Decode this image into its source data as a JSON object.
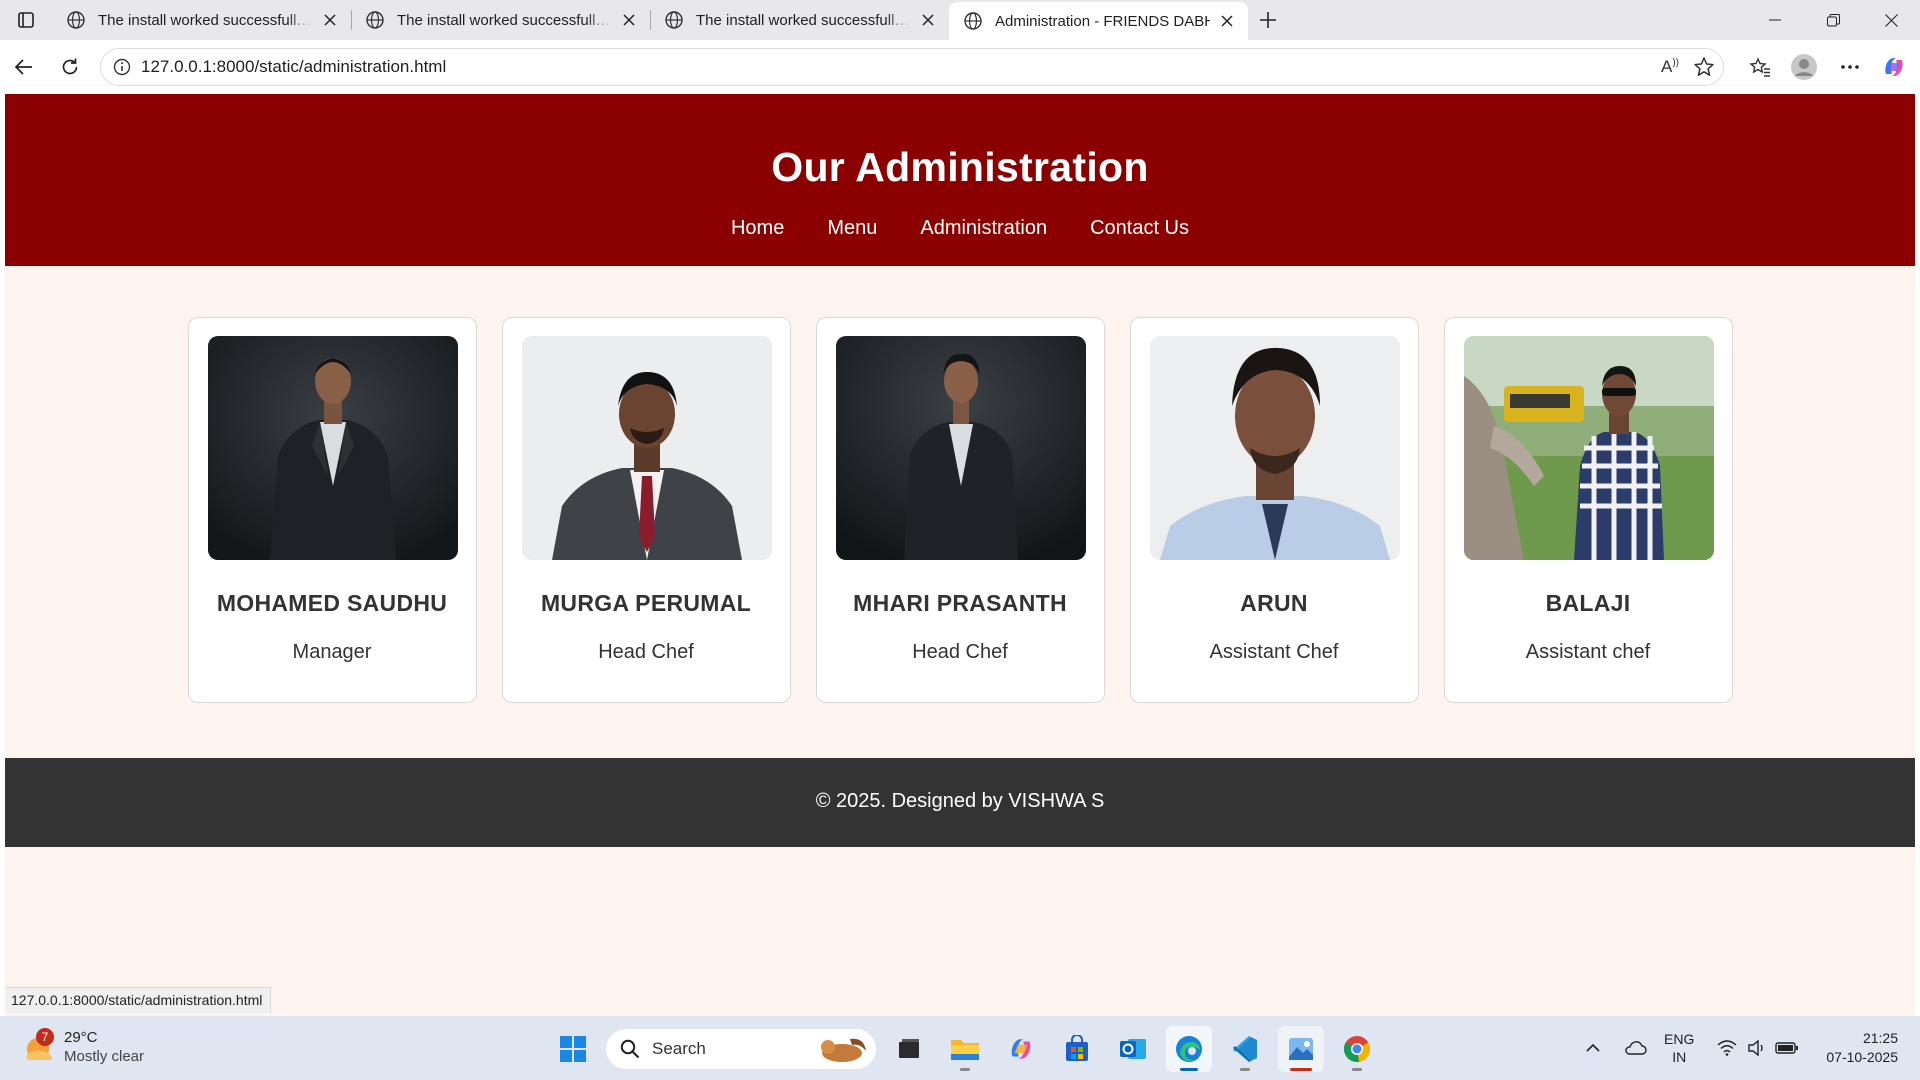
{
  "browser": {
    "tabs": [
      {
        "title": "The install worked successfully! Congratulations!",
        "active": false
      },
      {
        "title": "The install worked successfully! Congratulations!",
        "active": false
      },
      {
        "title": "The install worked successfully! Congratulations!",
        "active": false
      },
      {
        "title": "Administration - FRIENDS DABHA",
        "active": true
      }
    ],
    "url": "127.0.0.1:8000/static/administration.html",
    "status_url": "127.0.0.1:8000/static/administration.html"
  },
  "page": {
    "title": "Our Administration",
    "nav": [
      "Home",
      "Menu",
      "Administration",
      "Contact Us"
    ],
    "team": [
      {
        "name": "MOHAMED SAUDHU",
        "role": "Manager"
      },
      {
        "name": "MURGA PERUMAL",
        "role": "Head Chef"
      },
      {
        "name": "MHARI PRASANTH",
        "role": "Head Chef"
      },
      {
        "name": "ARUN",
        "role": "Assistant Chef"
      },
      {
        "name": "BALAJI",
        "role": "Assistant chef"
      }
    ],
    "footer": "© 2025. Designed by VISHWA S"
  },
  "taskbar": {
    "weather": {
      "temp": "29°C",
      "desc": "Mostly clear",
      "badge": "7"
    },
    "search_label": "Search",
    "lang_line1": "ENG",
    "lang_line2": "IN",
    "time": "21:25",
    "date": "07-10-2025"
  },
  "colors": {
    "header": "#8b0000",
    "footer": "#333333",
    "page_bg": "#fdf4ef"
  }
}
